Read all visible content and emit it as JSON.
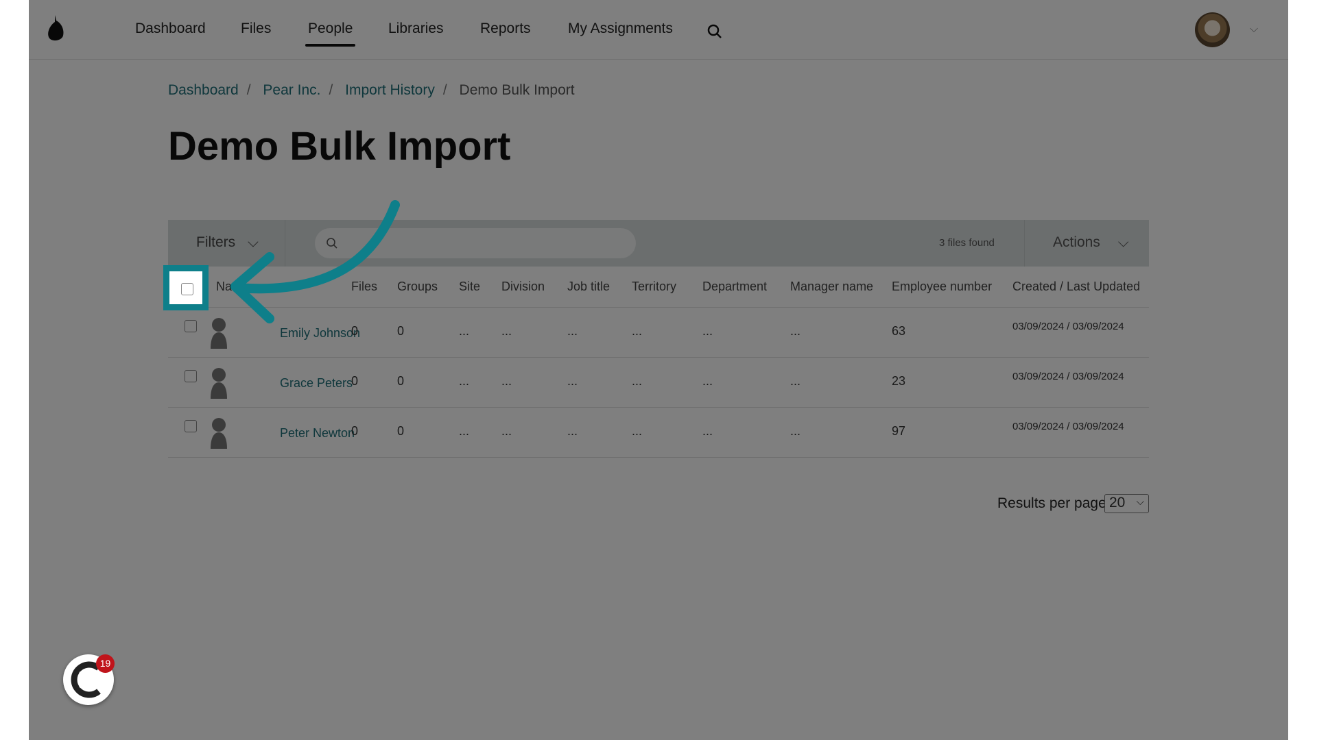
{
  "nav": {
    "items": [
      "Dashboard",
      "Files",
      "People",
      "Libraries",
      "Reports",
      "My Assignments"
    ],
    "active": "People"
  },
  "breadcrumb": [
    "Dashboard",
    "Pear Inc.",
    "Import History",
    "Demo Bulk Import"
  ],
  "title": "Demo Bulk Import",
  "toolbar": {
    "filters": "Filters",
    "search_placeholder": "",
    "found": "3 files found",
    "actions": "Actions"
  },
  "columns": [
    "Na",
    "Files",
    "Groups",
    "Site",
    "Division",
    "Job title",
    "Territory",
    "Department",
    "Manager name",
    "Employee number",
    "Created / Last Updated"
  ],
  "rows": [
    {
      "name": "Emily Johnson",
      "files": "0",
      "groups": "0",
      "site": "...",
      "division": "...",
      "job": "...",
      "territory": "...",
      "department": "...",
      "manager": "...",
      "emp": "63",
      "dates": "03/09/2024 / 03/09/2024"
    },
    {
      "name": "Grace Peters",
      "files": "0",
      "groups": "0",
      "site": "...",
      "division": "...",
      "job": "...",
      "territory": "...",
      "department": "...",
      "manager": "...",
      "emp": "23",
      "dates": "03/09/2024 / 03/09/2024"
    },
    {
      "name": "Peter Newton",
      "files": "0",
      "groups": "0",
      "site": "...",
      "division": "...",
      "job": "...",
      "territory": "...",
      "department": "...",
      "manager": "...",
      "emp": "97",
      "dates": "03/09/2024 / 03/09/2024"
    }
  ],
  "pagination": {
    "label": "Results per page:",
    "value": "20"
  },
  "widget": {
    "badge": "19"
  },
  "colors": {
    "accent": "#0e7f8a",
    "link": "#1e6f78",
    "badge": "#c0141b"
  }
}
